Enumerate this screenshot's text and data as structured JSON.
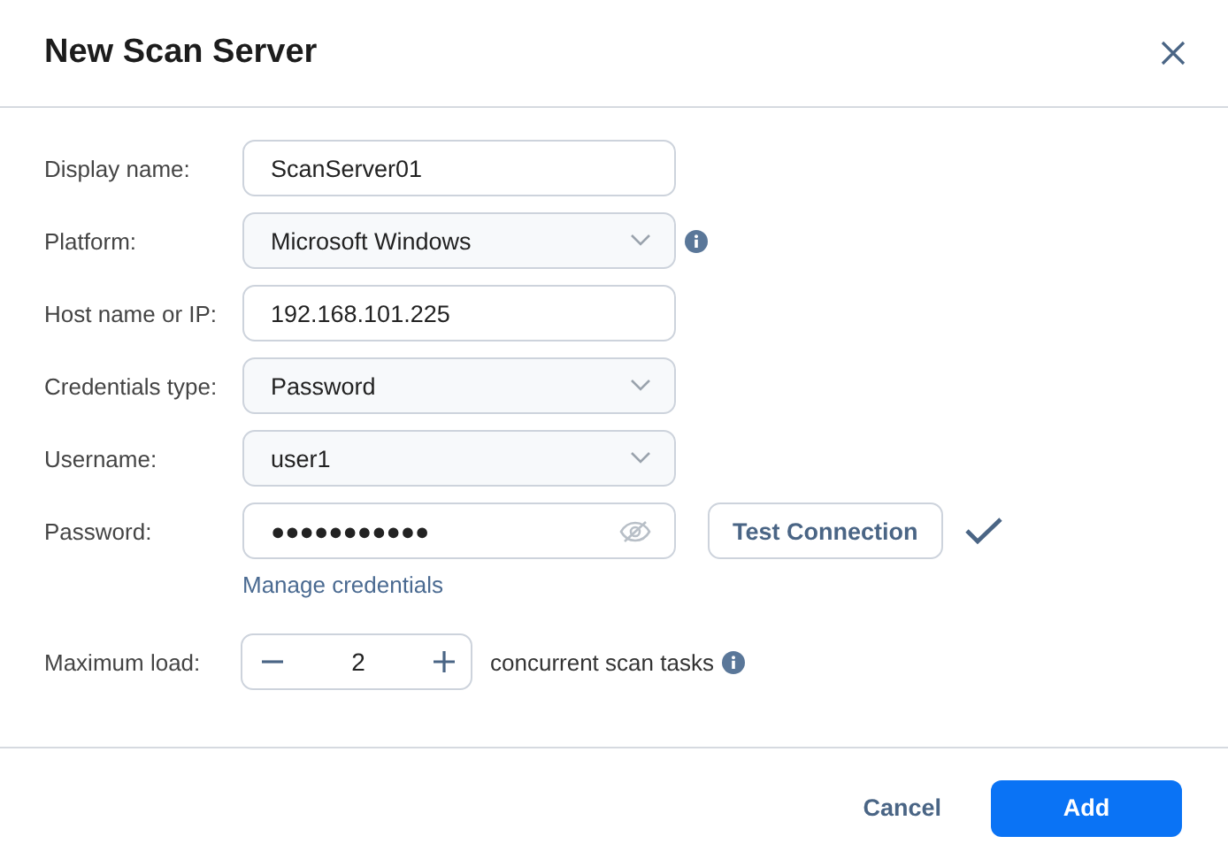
{
  "dialog": {
    "title": "New Scan Server"
  },
  "fields": [
    {
      "kind": "text",
      "label": "Display name:",
      "value": "ScanServer01"
    },
    {
      "kind": "select",
      "label": "Platform:",
      "value": "Microsoft Windows",
      "info": true
    },
    {
      "kind": "text",
      "label": "Host name or IP:",
      "value": "192.168.101.225"
    },
    {
      "kind": "select",
      "label": "Credentials type:",
      "value": "Password"
    },
    {
      "kind": "select",
      "label": "Username:",
      "value": "user1"
    },
    {
      "kind": "password",
      "label": "Password:",
      "value": "●●●●●●●●●●●",
      "button": "Test Connection",
      "verified": true,
      "link": "Manage credentials"
    },
    {
      "kind": "stepper",
      "label": "Maximum load:",
      "value": "2",
      "suffix": "concurrent scan tasks",
      "info": true
    }
  ],
  "buttons": [
    {
      "label": "Cancel",
      "kind": "secondary"
    },
    {
      "label": "Add",
      "kind": "primary"
    }
  ]
}
